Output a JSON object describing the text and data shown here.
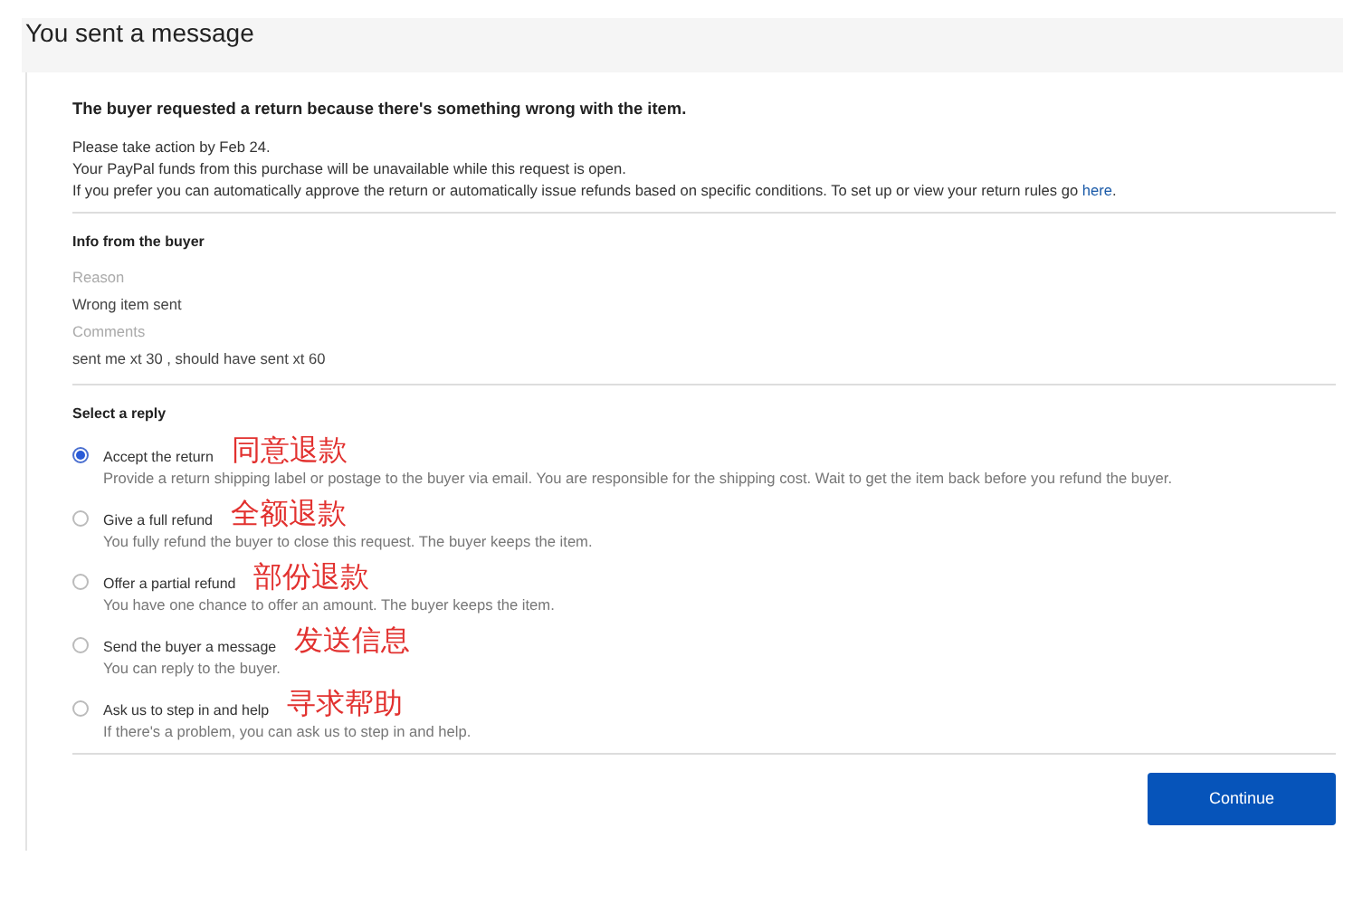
{
  "page_title": "You sent a message",
  "request": {
    "heading": "The buyer requested a return because there's something wrong with the item.",
    "lines": [
      "Please take action by Feb 24.",
      "Your PayPal funds from this purchase will be unavailable while this request is open."
    ],
    "rules_text": "If you prefer you can automatically approve the return or automatically issue refunds based on specific conditions. To set up or view your return rules go ",
    "rules_link": "here",
    "rules_end": "."
  },
  "buyer_info": {
    "heading": "Info from the buyer",
    "fields": [
      {
        "label": "Reason",
        "value": "Wrong item sent"
      },
      {
        "label": "Comments",
        "value": "sent me xt 30 , should have sent xt 60"
      }
    ]
  },
  "reply": {
    "heading": "Select a reply",
    "options": [
      {
        "label": "Accept the return",
        "note": "同意退款",
        "description": "Provide a return shipping label or postage to the buyer via email. You are responsible for the shipping cost. Wait to get the item back before you refund the buyer.",
        "selected": true
      },
      {
        "label": "Give a full refund",
        "note": "全额退款",
        "description": "You fully refund the buyer to close this request. The buyer keeps the item.",
        "selected": false
      },
      {
        "label": "Offer a partial refund",
        "note": "部份退款",
        "description": "You have one chance to offer an amount. The buyer keeps the item.",
        "selected": false
      },
      {
        "label": "Send the buyer a message",
        "note": "发送信息",
        "description": "You can reply to the buyer.",
        "selected": false
      },
      {
        "label": "Ask us to step in and help",
        "note": "寻求帮助",
        "description": "If there's a problem, you can ask us to step in and help.",
        "selected": false
      }
    ]
  },
  "continue_button": "Continue"
}
